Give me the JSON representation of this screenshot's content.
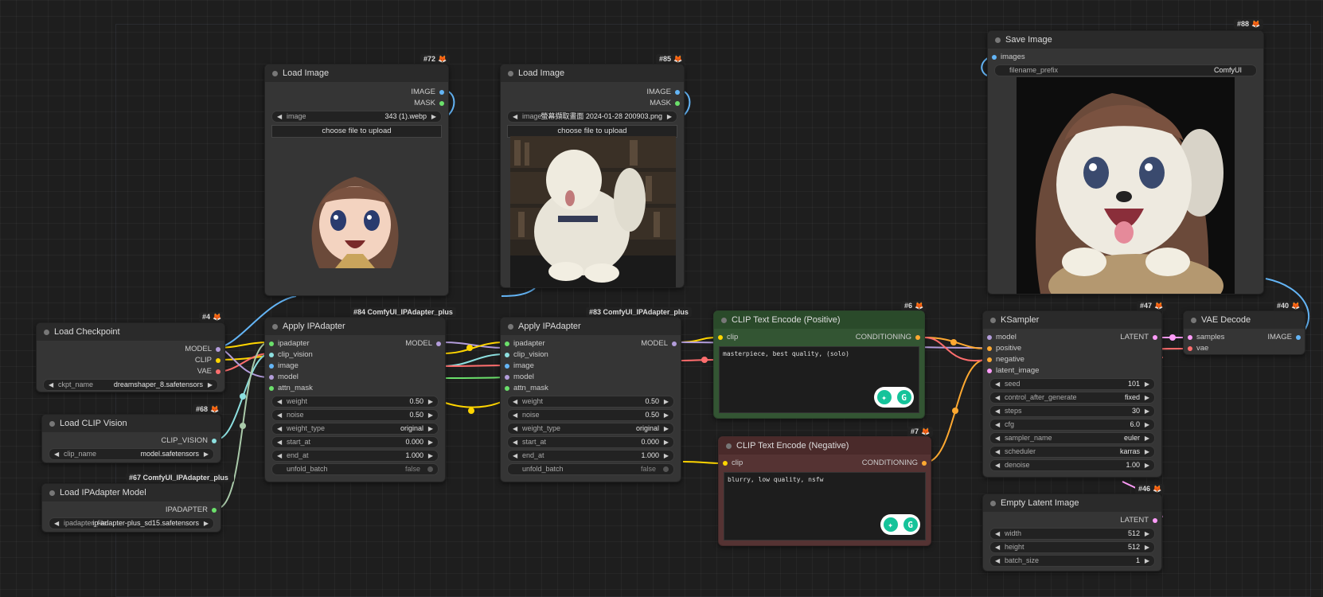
{
  "colors": {
    "model": "#b39ddb",
    "clip": "#ffd500",
    "vae": "#ff6e6e",
    "clip_vision": "#8de0e0",
    "ipadapter": "#6be06b",
    "image": "#64b5f6",
    "mask": "#6be06b",
    "conditioning": "#ffa931",
    "latent": "#ff9cf9"
  },
  "nodes": {
    "load_checkpoint": {
      "badge": "#4",
      "title": "Load Checkpoint",
      "outputs": [
        "MODEL",
        "CLIP",
        "VAE"
      ],
      "widgets": [
        {
          "label": "ckpt_name",
          "value": "dreamshaper_8.safetensors"
        }
      ]
    },
    "load_clip_vision": {
      "badge": "#68",
      "title": "Load CLIP Vision",
      "outputs": [
        "CLIP_VISION"
      ],
      "widgets": [
        {
          "label": "clip_name",
          "value": "model.safetensors"
        }
      ]
    },
    "load_ipadapter_model": {
      "badge": "#67 ComfyUI_IPAdapter_plus",
      "title": "Load IPAdapter Model",
      "outputs": [
        "IPADAPTER"
      ],
      "widgets": [
        {
          "label": "ipadapter_file",
          "value": "ip-adapter-plus_sd15.safetensors"
        }
      ]
    },
    "load_image_1": {
      "badge": "#72",
      "title": "Load Image",
      "outputs": [
        "IMAGE",
        "MASK"
      ],
      "widgets": [
        {
          "label": "image",
          "value": "343 (1).webp"
        }
      ],
      "button": "choose file to upload"
    },
    "load_image_2": {
      "badge": "#85",
      "title": "Load Image",
      "outputs": [
        "IMAGE",
        "MASK"
      ],
      "widgets": [
        {
          "label": "image",
          "value": "螢幕擷取畫面 2024-01-28 200903.png"
        }
      ],
      "button": "choose file to upload"
    },
    "apply_ipadapter_1": {
      "badge": "#84 ComfyUI_IPAdapter_plus",
      "title": "Apply IPAdapter",
      "inputs": [
        "ipadapter",
        "clip_vision",
        "image",
        "model",
        "attn_mask"
      ],
      "outputs": [
        "MODEL"
      ],
      "widgets": [
        {
          "label": "weight",
          "value": "0.50"
        },
        {
          "label": "noise",
          "value": "0.50"
        },
        {
          "label": "weight_type",
          "value": "original"
        },
        {
          "label": "start_at",
          "value": "0.000"
        },
        {
          "label": "end_at",
          "value": "1.000"
        }
      ],
      "toggle": {
        "label": "unfold_batch",
        "value": "false"
      }
    },
    "apply_ipadapter_2": {
      "badge": "#83 ComfyUI_IPAdapter_plus",
      "title": "Apply IPAdapter",
      "inputs": [
        "ipadapter",
        "clip_vision",
        "image",
        "model",
        "attn_mask"
      ],
      "outputs": [
        "MODEL"
      ],
      "widgets": [
        {
          "label": "weight",
          "value": "0.50"
        },
        {
          "label": "noise",
          "value": "0.50"
        },
        {
          "label": "weight_type",
          "value": "original"
        },
        {
          "label": "start_at",
          "value": "0.000"
        },
        {
          "label": "end_at",
          "value": "1.000"
        }
      ],
      "toggle": {
        "label": "unfold_batch",
        "value": "false"
      }
    },
    "clip_positive": {
      "badge": "#6",
      "title": "CLIP Text Encode (Positive)",
      "inputs": [
        "clip"
      ],
      "outputs": [
        "CONDITIONING"
      ],
      "text": "masterpiece, best quality, (solo)"
    },
    "clip_negative": {
      "badge": "#7",
      "title": "CLIP Text Encode (Negative)",
      "inputs": [
        "clip"
      ],
      "outputs": [
        "CONDITIONING"
      ],
      "text": "blurry, low quality, nsfw"
    },
    "ksampler": {
      "badge": "#47",
      "title": "KSampler",
      "inputs": [
        "model",
        "positive",
        "negative",
        "latent_image"
      ],
      "outputs": [
        "LATENT"
      ],
      "widgets": [
        {
          "label": "seed",
          "value": "101"
        },
        {
          "label": "control_after_generate",
          "value": "fixed"
        },
        {
          "label": "steps",
          "value": "30"
        },
        {
          "label": "cfg",
          "value": "6.0"
        },
        {
          "label": "sampler_name",
          "value": "euler"
        },
        {
          "label": "scheduler",
          "value": "karras"
        },
        {
          "label": "denoise",
          "value": "1.00"
        }
      ]
    },
    "vae_decode": {
      "badge": "#40",
      "title": "VAE Decode",
      "inputs": [
        "samples",
        "vae"
      ],
      "outputs": [
        "IMAGE"
      ]
    },
    "empty_latent": {
      "badge": "#46",
      "title": "Empty Latent Image",
      "outputs": [
        "LATENT"
      ],
      "widgets": [
        {
          "label": "width",
          "value": "512"
        },
        {
          "label": "height",
          "value": "512"
        },
        {
          "label": "batch_size",
          "value": "1"
        }
      ]
    },
    "save_image": {
      "badge": "#88",
      "title": "Save Image",
      "inputs": [
        "images"
      ],
      "widgets": [
        {
          "label": "filename_prefix",
          "value": "ComfyUI"
        }
      ]
    }
  },
  "grammarly_label": "G"
}
